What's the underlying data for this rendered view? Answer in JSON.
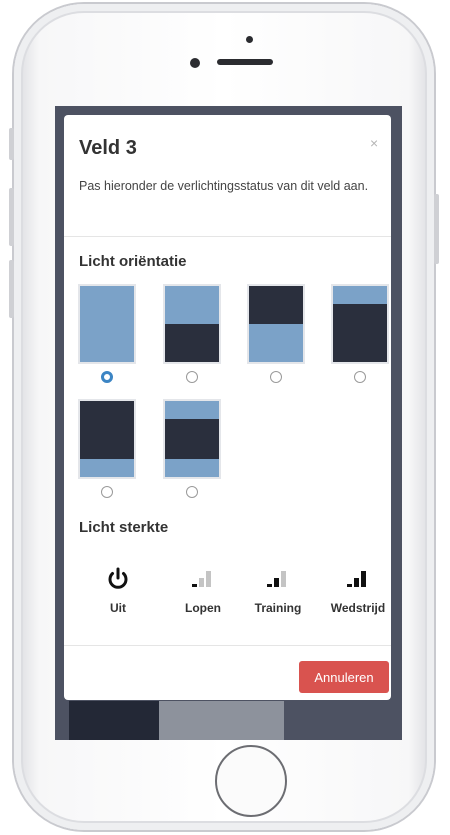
{
  "modal": {
    "title": "Veld 3",
    "close_symbol": "×",
    "description": "Pas hieronder de verlichtingsstatus van dit veld aan."
  },
  "orientation": {
    "heading": "Licht oriëntatie",
    "light_color": "#7ba2c8",
    "dark_color": "#2a2f3d",
    "options": [
      {
        "id": "full",
        "selected": true
      },
      {
        "id": "top-half",
        "selected": false
      },
      {
        "id": "bottom-half",
        "selected": false
      },
      {
        "id": "top-strip",
        "selected": false
      },
      {
        "id": "bottom-strip",
        "selected": false
      },
      {
        "id": "top-bottom-strips",
        "selected": false
      }
    ]
  },
  "strength": {
    "heading": "Licht sterkte",
    "options": [
      {
        "label": "Uit",
        "icon": "power-icon",
        "level": 0
      },
      {
        "label": "Lopen",
        "icon": "signal-low-icon",
        "level": 1
      },
      {
        "label": "Training",
        "icon": "signal-medium-icon",
        "level": 2
      },
      {
        "label": "Wedstrijd",
        "icon": "signal-high-icon",
        "level": 3
      }
    ]
  },
  "footer": {
    "cancel_label": "Annuleren",
    "cancel_color": "#d9534f"
  }
}
